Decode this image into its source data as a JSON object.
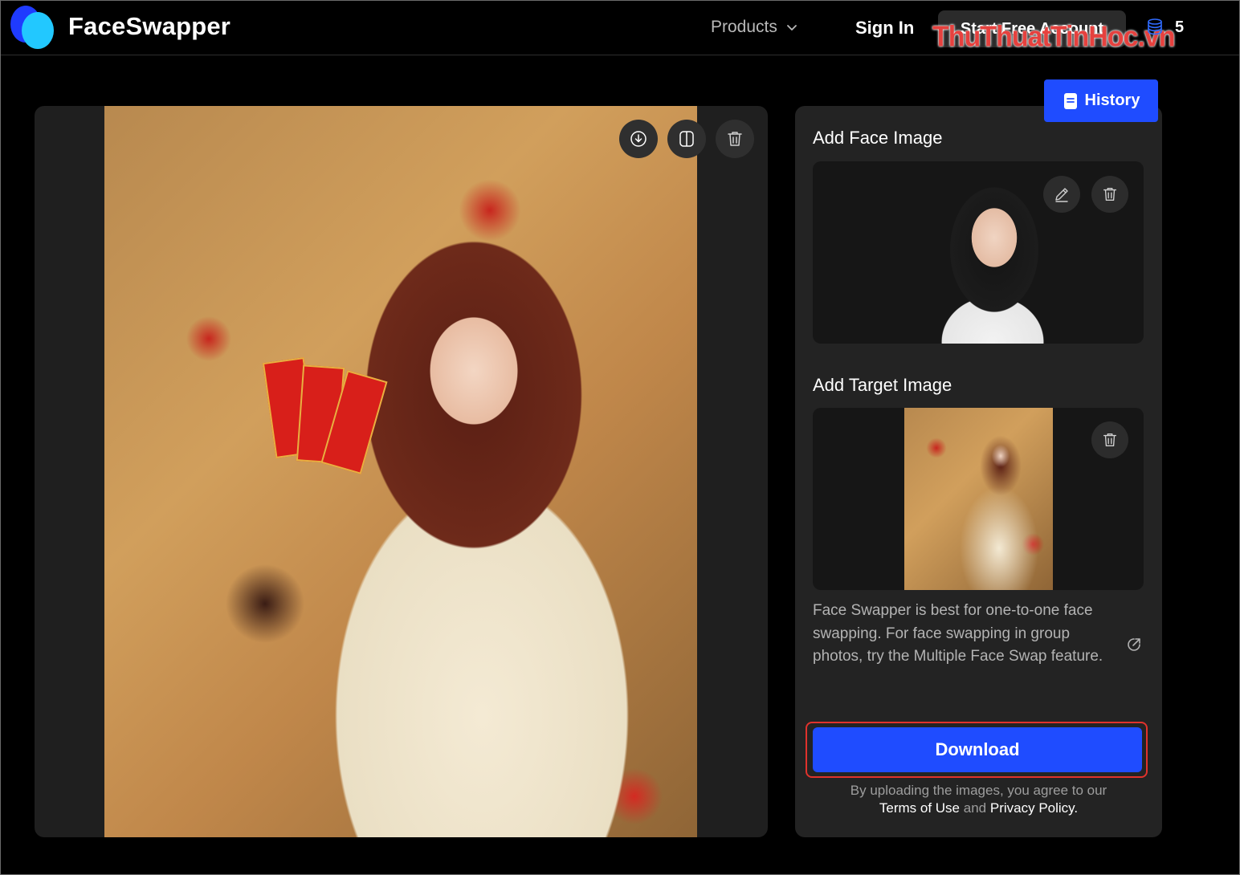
{
  "header": {
    "brand": "FaceSwapper",
    "products_label": "Products",
    "signin_label": "Sign In",
    "start_label": "Start Free Account",
    "watermark": "ThuThuatTinHoc.vn",
    "credits": "5",
    "icons": {
      "logo": "faceswapper-logo-icon",
      "products": "chevron-down-icon",
      "credits": "coins-stack-icon"
    }
  },
  "history": {
    "label": "History",
    "icon": "history-document-icon"
  },
  "result": {
    "tools": [
      "download-icon",
      "compare-split-icon",
      "trash-icon"
    ]
  },
  "face_section": {
    "title": "Add Face Image",
    "tools": [
      "edit-pencil-icon",
      "trash-icon"
    ]
  },
  "target_section": {
    "title": "Add Target Image",
    "tools": [
      "trash-icon"
    ]
  },
  "description": "Face Swapper is best for one-to-one face swapping. For face swapping in group photos, try the Multiple Face Swap feature.",
  "download_label": "Download",
  "legal": {
    "line1": "By uploading the images, you agree to our",
    "terms": "Terms of Use",
    "and": "and",
    "privacy": "Privacy Policy."
  },
  "colors": {
    "accent": "#1f4cff",
    "highlight_border": "#e0322c",
    "watermark": "#e6413e"
  }
}
